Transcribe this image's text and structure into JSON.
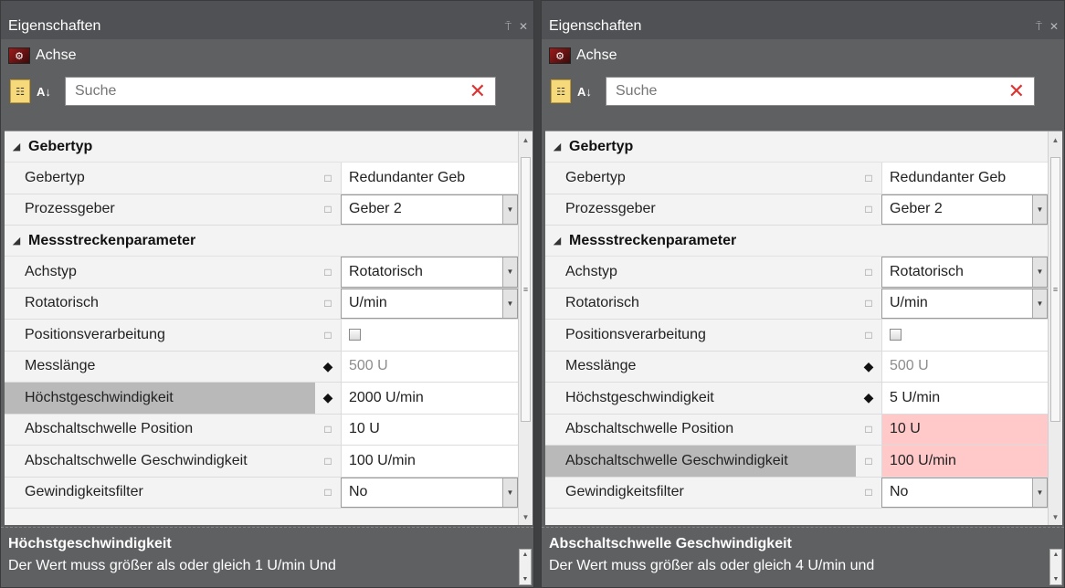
{
  "panels": [
    {
      "title": "Eigenschaften",
      "pin_icon": "pin-icon",
      "close_icon": "close-icon",
      "object": {
        "name": "Achse",
        "icon": "axis-icon"
      },
      "search": {
        "placeholder": "Suche"
      },
      "categories": [
        {
          "label": "Gebertyp",
          "rows": [
            {
              "name": "Gebertyp",
              "marker": "□",
              "value": "Redundanter Geb",
              "kind": "text"
            },
            {
              "name": "Prozessgeber",
              "marker": "□",
              "value": "Geber 2",
              "kind": "combo"
            }
          ]
        },
        {
          "label": "Messstreckenparameter",
          "rows": [
            {
              "name": "Achstyp",
              "marker": "□",
              "value": "Rotatorisch",
              "kind": "combo"
            },
            {
              "name": "Rotatorisch",
              "marker": "□",
              "value": "U/min",
              "kind": "combo"
            },
            {
              "name": "Positionsverarbeitung",
              "marker": "□",
              "value": "",
              "kind": "checkbox"
            },
            {
              "name": "Messlänge",
              "marker": "◆",
              "value": "500 U",
              "kind": "disabled"
            },
            {
              "name": "Höchstgeschwindigkeit",
              "marker": "◆",
              "value": "2000 U/min",
              "kind": "text",
              "selected": true
            },
            {
              "name": "Abschaltschwelle Position",
              "marker": "□",
              "value": "10 U",
              "kind": "text"
            },
            {
              "name": "Abschaltschwelle Geschwindigkeit",
              "marker": "□",
              "value": "100 U/min",
              "kind": "text"
            },
            {
              "name": "Gewindigkeitsfilter",
              "marker": "□",
              "value": "No",
              "kind": "combo"
            }
          ]
        }
      ],
      "description": {
        "title": "Höchstgeschwindigkeit",
        "text": "Der Wert muss größer als oder gleich 1  U/min Und"
      }
    },
    {
      "title": "Eigenschaften",
      "pin_icon": "pin-icon",
      "close_icon": "close-icon",
      "object": {
        "name": "Achse",
        "icon": "axis-icon"
      },
      "search": {
        "placeholder": "Suche"
      },
      "categories": [
        {
          "label": "Gebertyp",
          "rows": [
            {
              "name": "Gebertyp",
              "marker": "□",
              "value": "Redundanter Geb",
              "kind": "text"
            },
            {
              "name": "Prozessgeber",
              "marker": "□",
              "value": "Geber 2",
              "kind": "combo"
            }
          ]
        },
        {
          "label": "Messstreckenparameter",
          "rows": [
            {
              "name": "Achstyp",
              "marker": "□",
              "value": "Rotatorisch",
              "kind": "combo"
            },
            {
              "name": "Rotatorisch",
              "marker": "□",
              "value": "U/min",
              "kind": "combo"
            },
            {
              "name": "Positionsverarbeitung",
              "marker": "□",
              "value": "",
              "kind": "checkbox"
            },
            {
              "name": "Messlänge",
              "marker": "◆",
              "value": "500 U",
              "kind": "disabled"
            },
            {
              "name": "Höchstgeschwindigkeit",
              "marker": "◆",
              "value": "5 U/min",
              "kind": "text"
            },
            {
              "name": "Abschaltschwelle Position",
              "marker": "□",
              "value": "10 U",
              "kind": "error"
            },
            {
              "name": "Abschaltschwelle Geschwindigkeit",
              "marker": "□",
              "value": "100 U/min",
              "kind": "error",
              "selected": true
            },
            {
              "name": "Gewindigkeitsfilter",
              "marker": "□",
              "value": "No",
              "kind": "combo"
            }
          ]
        }
      ],
      "description": {
        "title": "Abschaltschwelle Geschwindigkeit",
        "text": "Der Wert muss größer als oder gleich 4  U/min und"
      }
    }
  ]
}
